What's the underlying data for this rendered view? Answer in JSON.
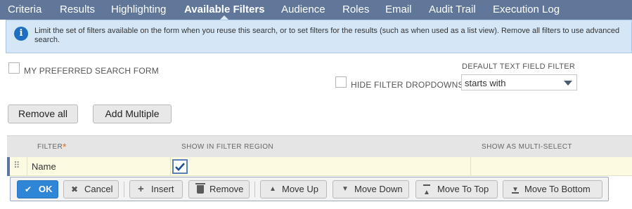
{
  "tabs": [
    {
      "label": "Criteria",
      "active": false
    },
    {
      "label": "Results",
      "active": false
    },
    {
      "label": "Highlighting",
      "active": false
    },
    {
      "label": "Available Filters",
      "active": true
    },
    {
      "label": "Audience",
      "active": false
    },
    {
      "label": "Roles",
      "active": false
    },
    {
      "label": "Email",
      "active": false
    },
    {
      "label": "Audit Trail",
      "active": false
    },
    {
      "label": "Execution Log",
      "active": false
    }
  ],
  "info": {
    "icon": "info-icon",
    "text": "Limit the set of filters available on the form when you reuse this search, or to set filters for the results (such as when used as a list view). Remove all filters to use advanced search."
  },
  "options": {
    "preferred_form": {
      "label": "MY PREFERRED SEARCH FORM",
      "checked": false
    },
    "hide_dropdowns": {
      "label": "HIDE FILTER DROPDOWNS",
      "checked": false
    },
    "default_filter": {
      "label": "DEFAULT TEXT FIELD FILTER",
      "value": "starts with"
    }
  },
  "buttons": {
    "remove_all": "Remove all",
    "add_multiple": "Add Multiple"
  },
  "table": {
    "columns": [
      "FILTER",
      "SHOW IN FILTER REGION",
      "SHOW AS MULTI-SELECT"
    ],
    "required_marker": "*",
    "rows": [
      {
        "filter": "Name",
        "show_in_filter_region": true,
        "show_as_multi_select": false
      }
    ]
  },
  "toolbar": {
    "ok": "OK",
    "cancel": "Cancel",
    "insert": "Insert",
    "remove": "Remove",
    "move_up": "Move Up",
    "move_down": "Move Down",
    "move_to_top": "Move To Top",
    "move_to_bottom": "Move To Bottom"
  },
  "colors": {
    "tabbar": "#607799",
    "info_bg": "#d5e7f7",
    "primary_button": "#2f86d6",
    "row_highlight": "#fcfbe2",
    "required": "#e2701b"
  }
}
